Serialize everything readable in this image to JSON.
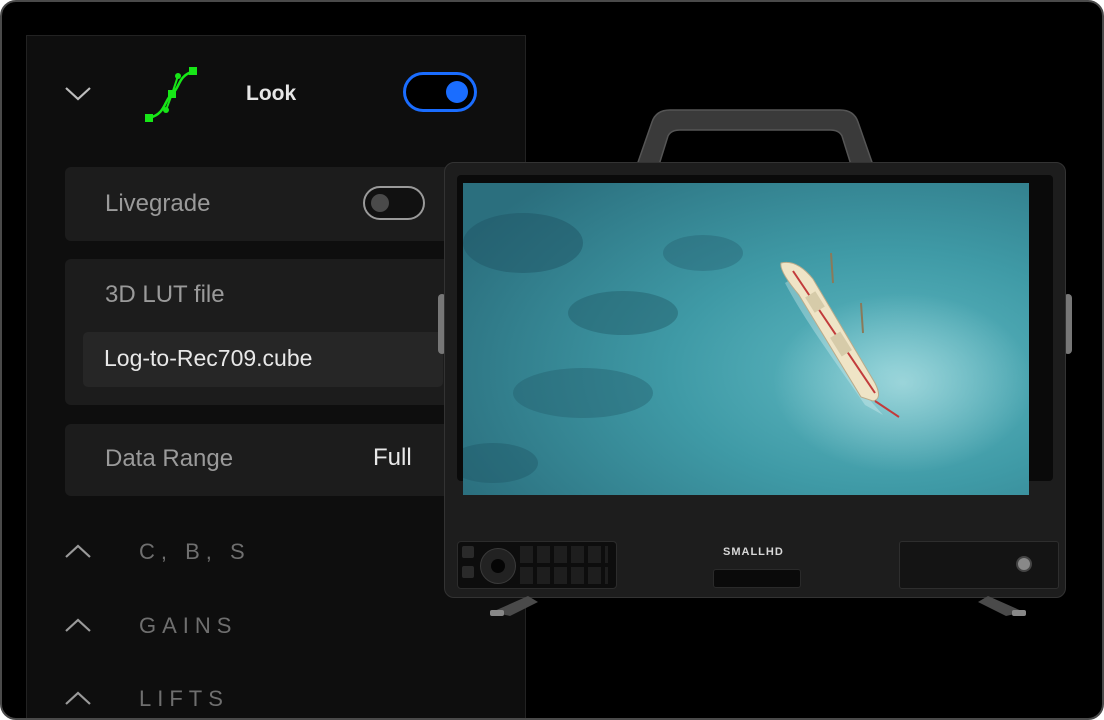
{
  "look": {
    "title": "Look",
    "enabled": true,
    "accent_color": "#1a6dff",
    "curve_icon_color": "#17e617"
  },
  "livegrade": {
    "label": "Livegrade",
    "enabled": false
  },
  "lut": {
    "label": "3D LUT file",
    "value": "Log-to-Rec709.cube"
  },
  "data_range": {
    "label": "Data Range",
    "value": "Full"
  },
  "sections": [
    {
      "label": "C, B, S"
    },
    {
      "label": "GAINS"
    },
    {
      "label": "LIFTS"
    }
  ],
  "monitor": {
    "brand": "SMALLHD"
  }
}
